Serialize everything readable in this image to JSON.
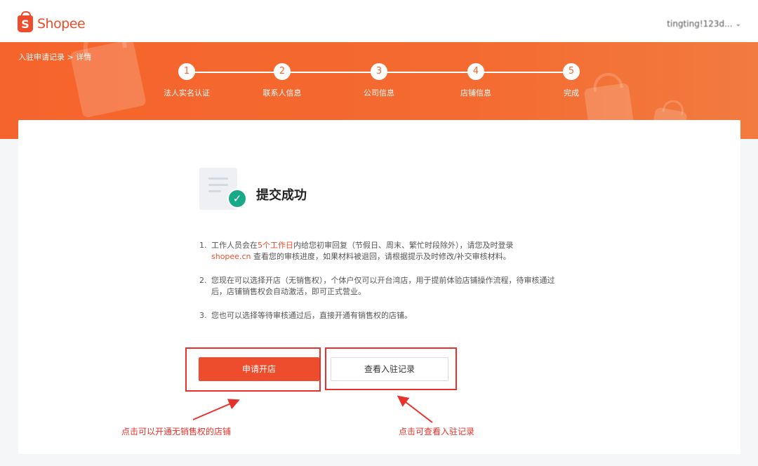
{
  "header": {
    "logo_text": "Shopee",
    "logo_mark": "S",
    "username": "tingting!123d...",
    "dropdown_icon": "chevron-down-icon"
  },
  "banner": {
    "breadcrumb": "入驻申请记录 > 详情",
    "steps": [
      {
        "num": "1",
        "label": "法人实名认证"
      },
      {
        "num": "2",
        "label": "联系人信息"
      },
      {
        "num": "3",
        "label": "公司信息"
      },
      {
        "num": "4",
        "label": "店铺信息"
      },
      {
        "num": "5",
        "label": "完成"
      }
    ]
  },
  "main": {
    "status_icon": "document-check-icon",
    "title": "提交成功",
    "notes": [
      {
        "num": "1.",
        "before": "工作人员会在",
        "highlight": "5个工作日",
        "after": "内给您初审回复（节假日、周末、繁忙时段除外），请您及时登录",
        "link": "shopee.cn",
        "after_link": " 查看您的审核进度，如果材料被退回，请根据提示及时修改/补交审核材料。"
      },
      {
        "num": "2.",
        "text": "您现在可以选择开店（无销售权），个体户仅可以开台湾店，用于提前体验店铺操作流程，待审核通过后，店铺销售权会自动激活，即可正式营业。"
      },
      {
        "num": "3.",
        "text": "您也可以选择等待审核通过后，直接开通有销售权的店铺。"
      }
    ],
    "primary_button": "申请开店",
    "secondary_button": "查看入驻记录"
  },
  "annotations": {
    "left": "点击可以开通无销售权的店铺",
    "right": "点击可查看入驻记录",
    "color": "#e8312a"
  },
  "colors": {
    "brand": "#ee4d2d",
    "banner": "#f5642c",
    "success": "#1aa988"
  }
}
